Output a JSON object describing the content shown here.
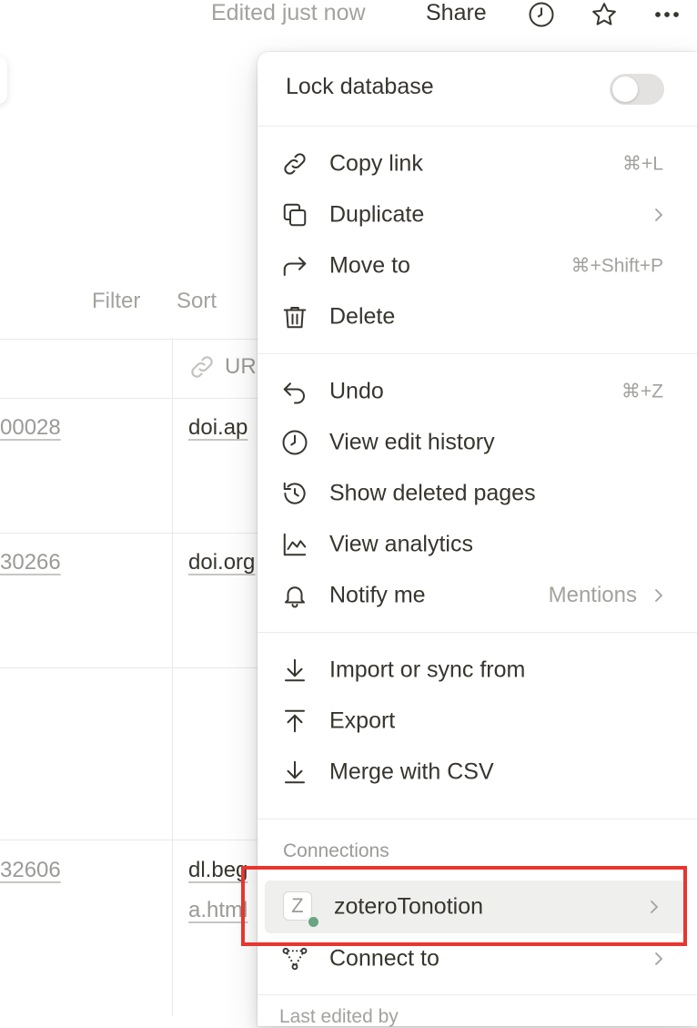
{
  "topbar": {
    "edited": "Edited just now",
    "share": "Share",
    "icons": [
      "clock-icon",
      "star-icon",
      "more-icon"
    ]
  },
  "toolbar": {
    "filter": "Filter",
    "sort": "Sort"
  },
  "table": {
    "url_header": "UR",
    "rows": [
      {
        "num": "00028",
        "url": "doi.ap"
      },
      {
        "num": "30266",
        "url": "doi.org"
      },
      {
        "num": "",
        "url": ""
      },
      {
        "num": "32606",
        "url": "dl.beg",
        "url2": "a.html"
      }
    ]
  },
  "menu": {
    "lock": {
      "label": "Lock database",
      "on": false
    },
    "group1": [
      {
        "icon": "link-icon",
        "label": "Copy link",
        "shortcut": "⌘+L"
      },
      {
        "icon": "duplicate-icon",
        "label": "Duplicate",
        "submenu": true
      },
      {
        "icon": "move-to-icon",
        "label": "Move to",
        "shortcut": "⌘+Shift+P"
      },
      {
        "icon": "trash-icon",
        "label": "Delete"
      }
    ],
    "group2": [
      {
        "icon": "undo-icon",
        "label": "Undo",
        "shortcut": "⌘+Z"
      },
      {
        "icon": "clock-icon",
        "label": "View edit history"
      },
      {
        "icon": "history-icon",
        "label": "Show deleted pages"
      },
      {
        "icon": "chart-icon",
        "label": "View analytics"
      },
      {
        "icon": "bell-icon",
        "label": "Notify me",
        "value": "Mentions",
        "submenu": true
      }
    ],
    "group3": [
      {
        "icon": "import-icon",
        "label": "Import or sync from"
      },
      {
        "icon": "export-icon",
        "label": "Export"
      },
      {
        "icon": "merge-icon",
        "label": "Merge with CSV"
      }
    ],
    "connections": {
      "header": "Connections",
      "zotero": {
        "badge": "Z",
        "label": "zoteroTonotion"
      },
      "connect_to": "Connect to"
    },
    "footer_peek": "Last edited by"
  },
  "colors": {
    "highlight": "#e8352e",
    "status_dot": "#6aa482"
  }
}
